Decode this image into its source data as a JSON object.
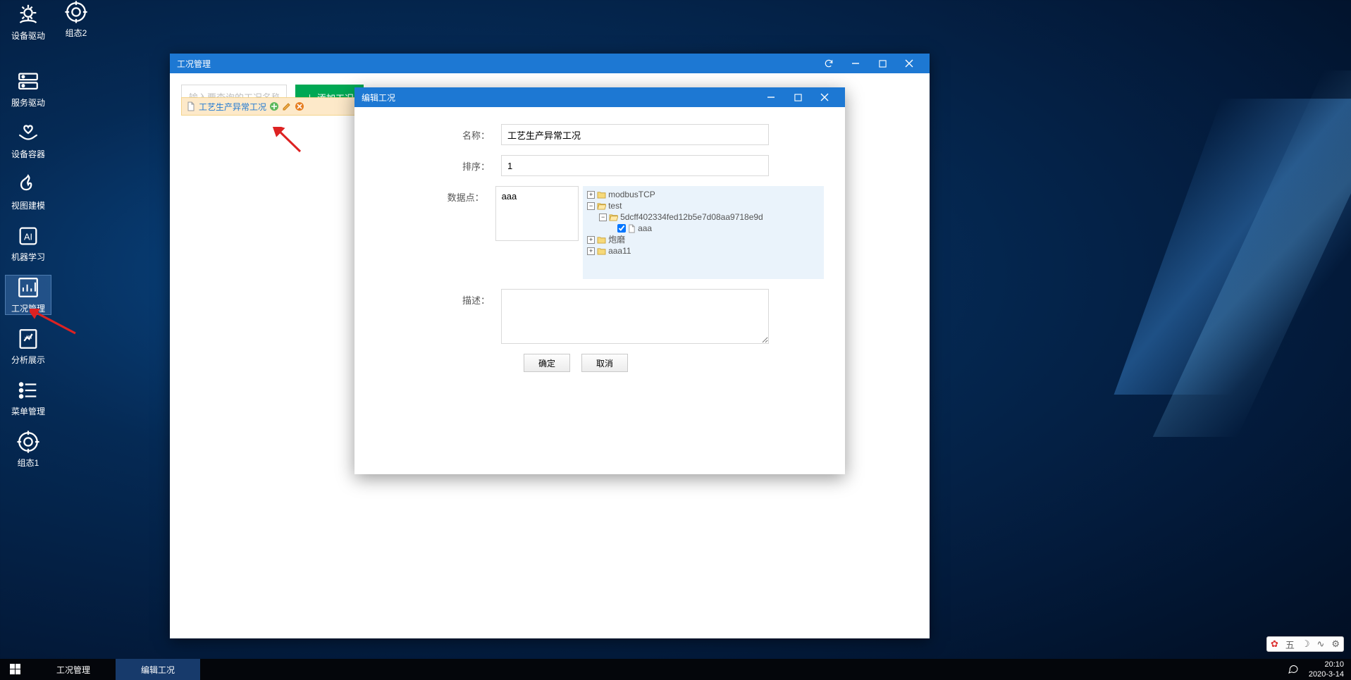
{
  "desktop": {
    "icons": [
      {
        "label": "设备驱动"
      },
      {
        "label": "组态2"
      },
      {
        "label": "服务驱动"
      },
      {
        "label": "设备容器"
      },
      {
        "label": "视图建模"
      },
      {
        "label": "机器学习"
      },
      {
        "label": "工况管理"
      },
      {
        "label": "分析展示"
      },
      {
        "label": "菜单管理"
      },
      {
        "label": "组态1"
      }
    ]
  },
  "main_window": {
    "title": "工况管理",
    "search_placeholder": "输入要查询的工况名称",
    "add_button": "添加工况",
    "list_item": "工艺生产异常工况"
  },
  "modal": {
    "title": "编辑工况",
    "labels": {
      "name": "名称：",
      "order": "排序：",
      "datapoint": "数据点：",
      "desc": "描述："
    },
    "values": {
      "name": "工艺生产异常工况",
      "order": "1",
      "datapoint": "aaa"
    },
    "tree": {
      "n0": "modbusTCP",
      "n1": "test",
      "n2": "5dcff402334fed12b5e7d08aa9718e9d",
      "n3": "aaa",
      "n4": "炮磨",
      "n5": "aaa11"
    },
    "ok_btn": "确定",
    "cancel_btn": "取消"
  },
  "taskbar": {
    "items": [
      "工况管理",
      "编辑工况"
    ]
  },
  "clock": {
    "time": "20:10",
    "date": "2020-3-14"
  },
  "tray_widget": {
    "t0": "五"
  }
}
